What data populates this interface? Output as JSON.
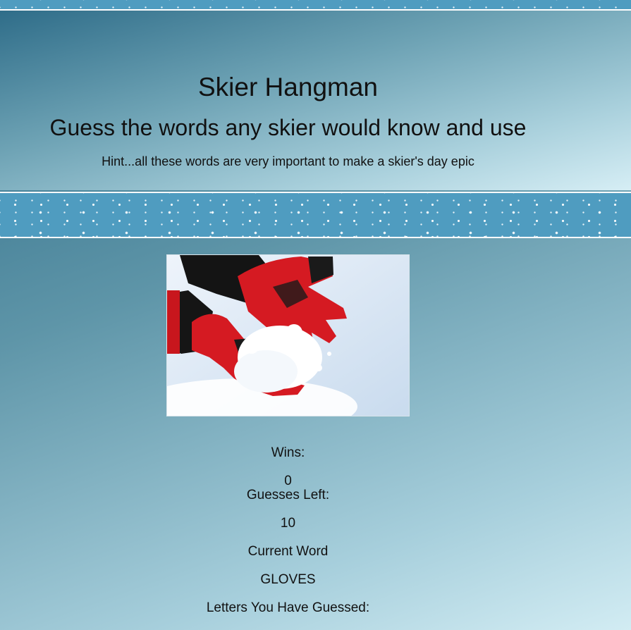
{
  "header": {
    "title": "Skier Hangman",
    "subtitle": "Guess the words any skier would know and use",
    "hint": "Hint...all these words are very important to make a skier's day epic"
  },
  "game": {
    "wins_label": "Wins:",
    "wins_value": "0",
    "guesses_left_label": "Guesses Left:",
    "guesses_left_value": "10",
    "current_word_label": "Current Word",
    "current_word_value": "GLOVES",
    "letters_guessed_label": "Letters You Have Guessed:"
  },
  "colors": {
    "snow_strip": "#4f9cc0",
    "glove_red": "#d51a22",
    "text": "#111111"
  }
}
